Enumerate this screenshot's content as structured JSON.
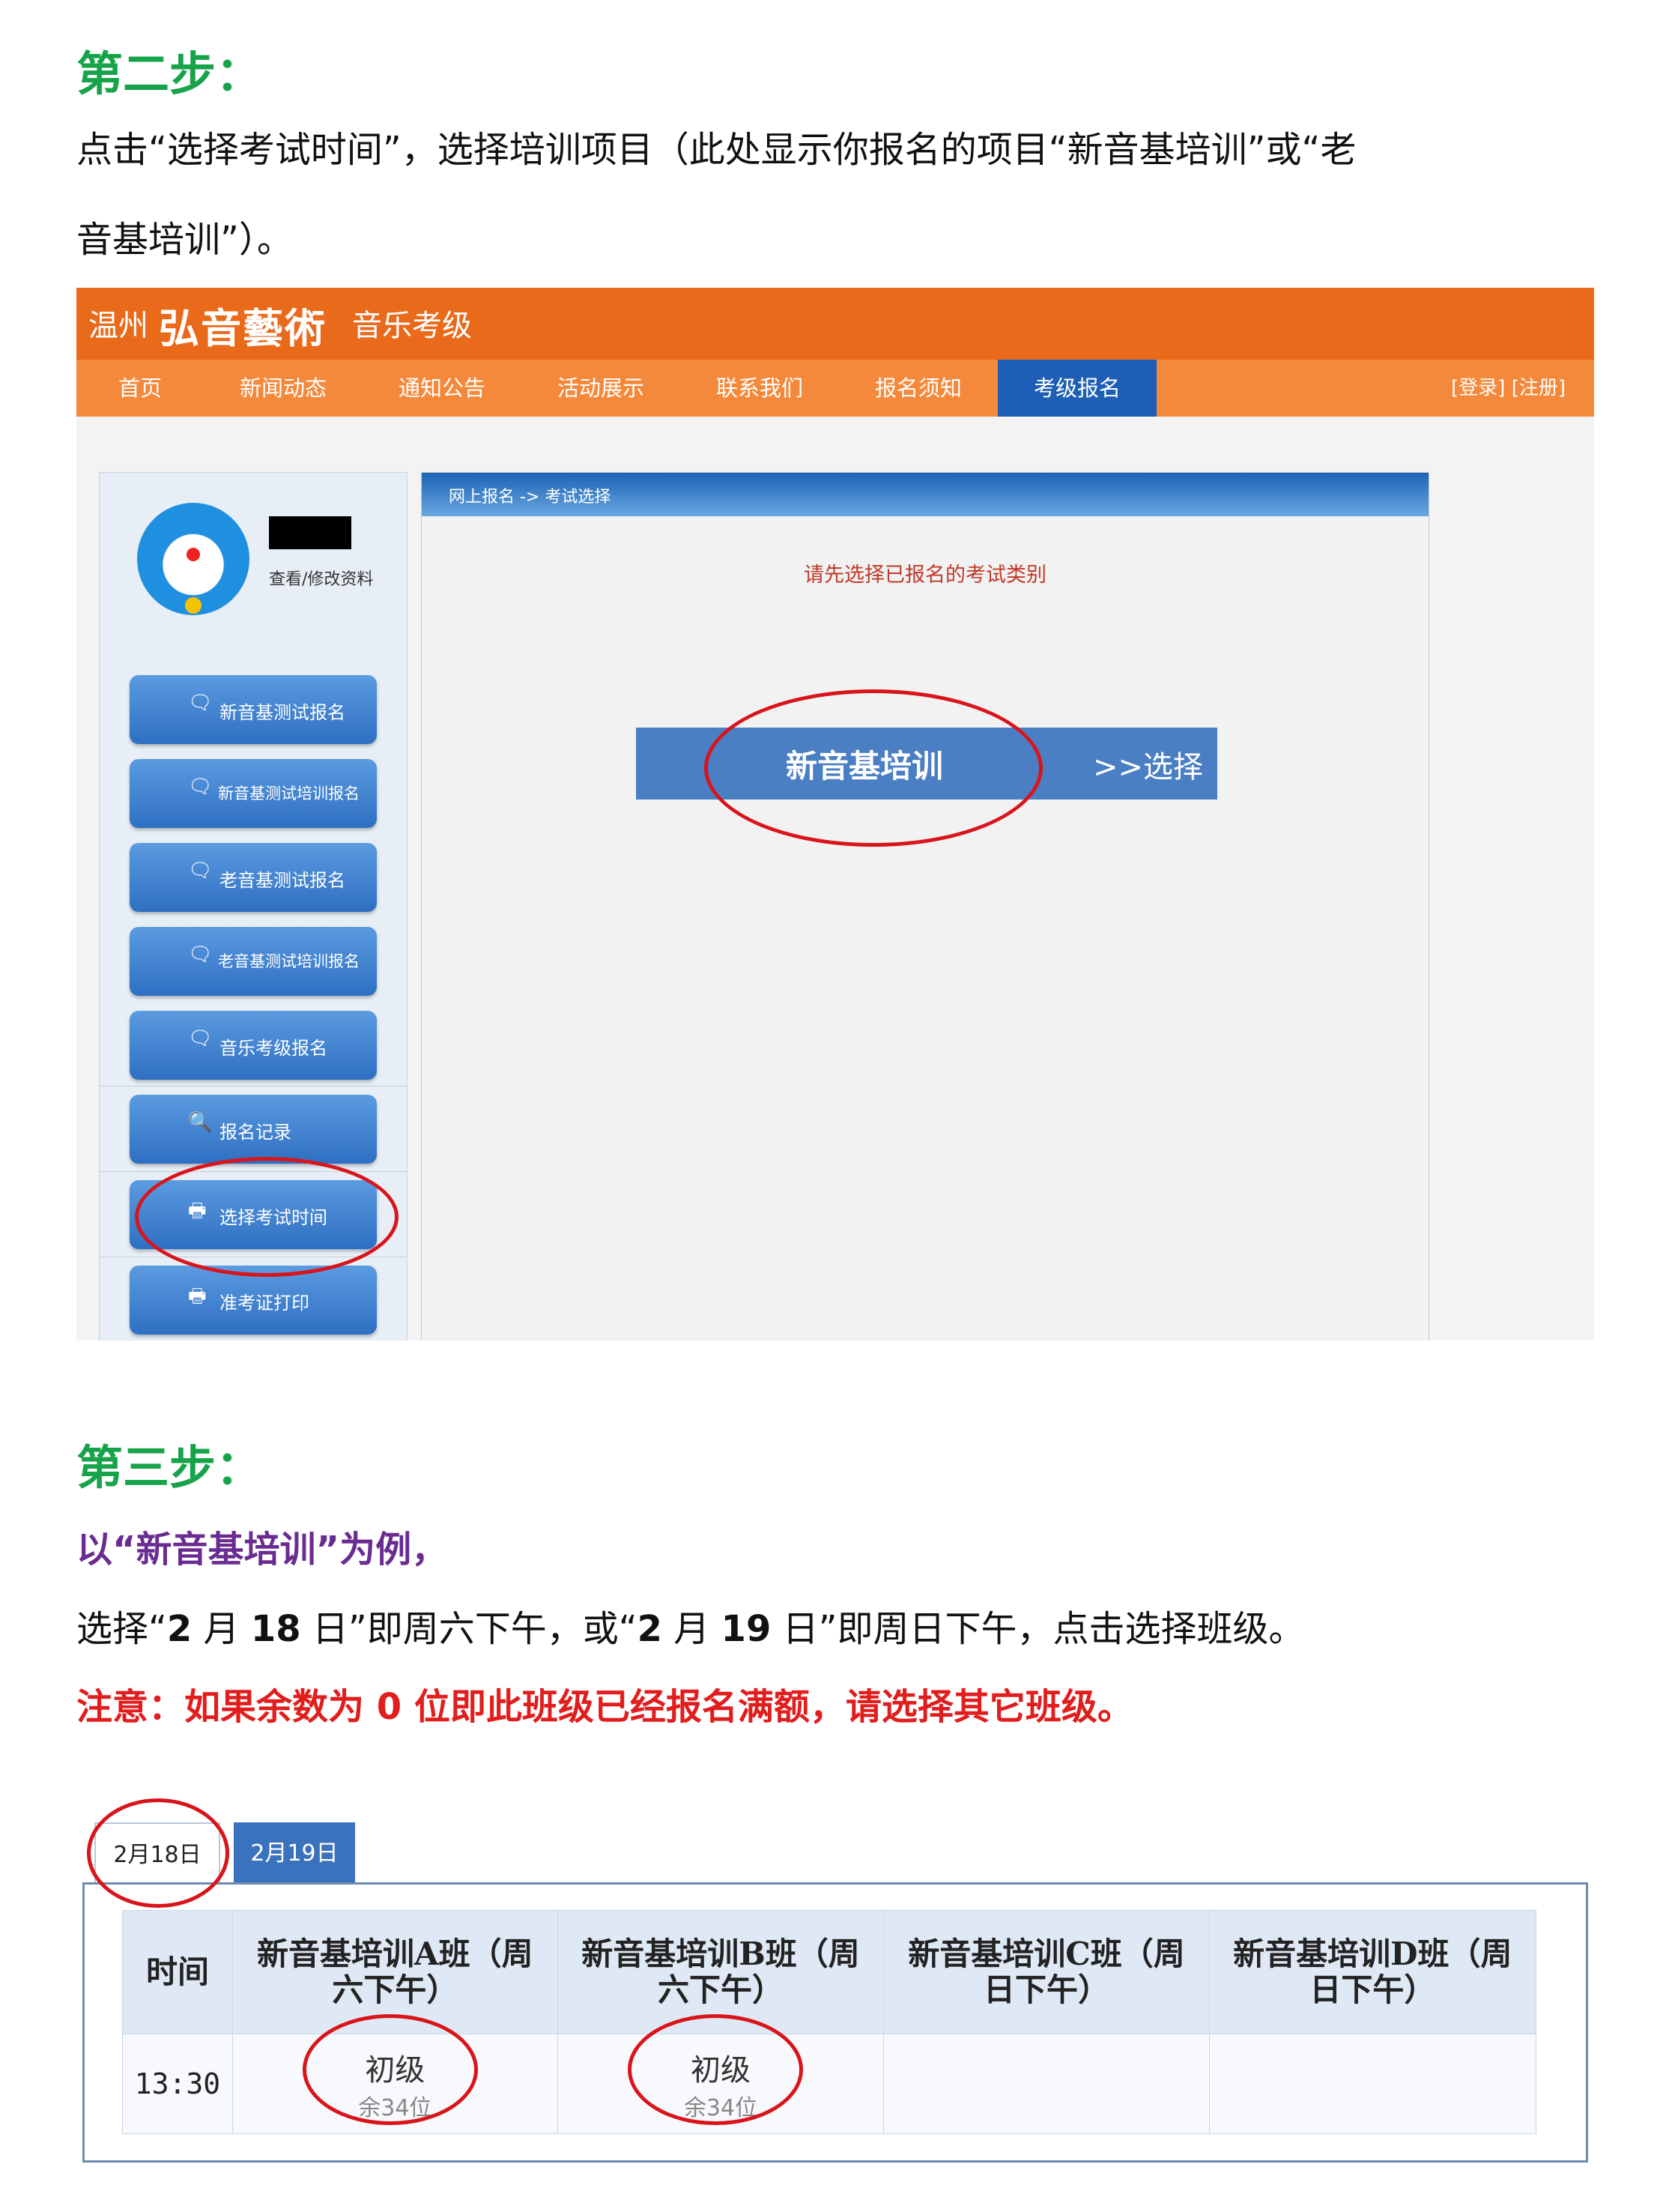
{
  "step2": {
    "heading": "第二步：",
    "line1": "点击“选择考试时间”，选择培训项目（此处显示你报名的项目“新音基培训”或“老",
    "line2": "音基培训”）。"
  },
  "site": {
    "city": "温州",
    "logo": "弘音藝術",
    "subtitle": "音乐考级",
    "nav": [
      "首页",
      "新闻动态",
      "通知公告",
      "活动展示",
      "联系我们",
      "报名须知",
      "考级报名"
    ],
    "active_nav": "考级报名",
    "login": "[登录] [注册]",
    "profile_link": "查看/修改资料",
    "sidebar_buttons": [
      {
        "label": "新音基测试报名",
        "icon": "chat-icon"
      },
      {
        "label": "新音基测试培训报名",
        "icon": "chat-icon"
      },
      {
        "label": "老音基测试报名",
        "icon": "chat-icon"
      },
      {
        "label": "老音基测试培训报名",
        "icon": "chat-icon"
      },
      {
        "label": "音乐考级报名",
        "icon": "chat-icon"
      },
      {
        "label": "报名记录",
        "icon": "search-icon"
      },
      {
        "label": "选择考试时间",
        "icon": "printer-icon"
      },
      {
        "label": "准考证打印",
        "icon": "printer-icon"
      }
    ],
    "breadcrumb": "网上报名 -> 考试选择",
    "prompt": "请先选择已报名的考试类别",
    "exam_name": "新音基培训",
    "select_label": ">>选择"
  },
  "step3": {
    "heading": "第三步：",
    "example": "以“新音基培训”为例，",
    "instruction_pre": "选择“",
    "date1": "2",
    "month1": " 月 ",
    "day1": "18",
    "ri1": " 日”即周六下午，或“",
    "date2": "2",
    "month2": " 月 ",
    "day2": "19",
    "ri2": " 日”即周日下午，点击选择班级。",
    "note_pre": "注意：如果余数为",
    "note_zero": " 0 ",
    "note_post": "位即此班级已经报名满额，请选择其它班级。"
  },
  "schedule": {
    "tabs": [
      "2月18日",
      "2月19日"
    ],
    "selected_tab": "2月18日",
    "headers": [
      "时间",
      "新音基培训A班（周六下午）",
      "新音基培训B班（周六下午）",
      "新音基培训C班（周日下午）",
      "新音基培训D班（周日下午）"
    ],
    "rows": [
      {
        "time": "13:30",
        "cells": [
          {
            "level": "初级",
            "seats": "余34位"
          },
          {
            "level": "初级",
            "seats": "余34位"
          },
          {
            "level": "",
            "seats": ""
          },
          {
            "level": "",
            "seats": ""
          }
        ]
      }
    ]
  },
  "colors": {
    "highlight_circle": "#d9141b",
    "heading_green": "#17a34a",
    "brand_orange": "#ea6a1c",
    "nav_active": "#1e5fb5"
  }
}
